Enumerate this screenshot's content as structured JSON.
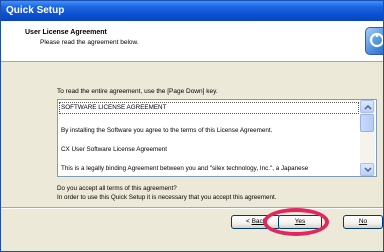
{
  "window": {
    "title": "Quick Setup"
  },
  "header": {
    "title": "User License Agreement",
    "subtitle": "Please read the agreement below.",
    "icon": "setup-wizard-icon"
  },
  "main": {
    "instruction": "To read the entire agreement, use the [Page Down] key.",
    "license_lines": [
      "SOFTWARE LICENSE AGREEMENT",
      "By installing the Software you agree to the terms of this License Agreement.",
      "CX User Software License Agreement",
      "This is a legally binding Agreement between you and \"silex technology, Inc.\", a Japanese"
    ],
    "question_line1": "Do you accept all terms of this agreement?",
    "question_line2": "In order to use this Quick Setup it is necessary that you accept this agreement."
  },
  "buttons": {
    "back_prefix": "< ",
    "back_label": "Back",
    "yes_label": "Yes",
    "no_label": "No"
  },
  "colors": {
    "titlebar": "#0a4fd2",
    "highlight_ring": "#e0275f",
    "dialog_bg": "#ece9d8"
  }
}
